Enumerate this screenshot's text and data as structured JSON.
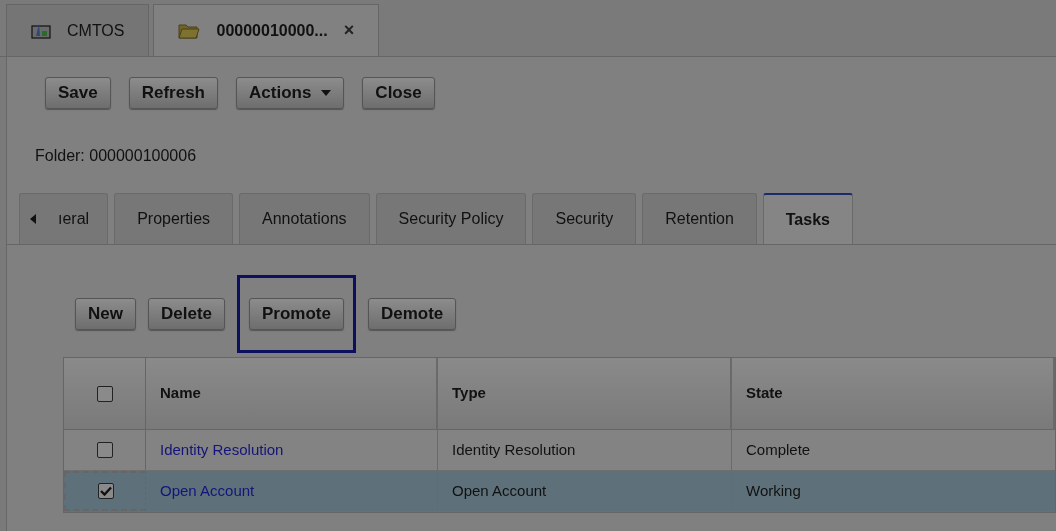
{
  "main_tabs": [
    {
      "label": "CMTOS",
      "kind": "app",
      "selected": false
    },
    {
      "label": "00000010000...",
      "kind": "folder",
      "selected": true,
      "close": "×"
    }
  ],
  "toolbar": [
    {
      "label": "Save",
      "dropdown": false
    },
    {
      "label": "Refresh",
      "dropdown": false
    },
    {
      "label": "Actions",
      "dropdown": true
    },
    {
      "label": "Close",
      "dropdown": false
    }
  ],
  "folder_label": "Folder: 000000100006",
  "detail_tabs": [
    {
      "label": "ıeral",
      "selected": false
    },
    {
      "label": "Properties",
      "selected": false
    },
    {
      "label": "Annotations",
      "selected": false
    },
    {
      "label": "Security Policy",
      "selected": false
    },
    {
      "label": "Security",
      "selected": false
    },
    {
      "label": "Retention",
      "selected": false
    },
    {
      "label": "Tasks",
      "selected": true
    }
  ],
  "task_buttons": [
    {
      "label": "New",
      "highlighted": false
    },
    {
      "label": "Delete",
      "highlighted": false
    },
    {
      "label": "Promote",
      "highlighted": true
    },
    {
      "label": "Demote",
      "highlighted": false
    }
  ],
  "table": {
    "header_checked": false,
    "columns": [
      "Name",
      "Type",
      "State"
    ],
    "rows": [
      {
        "checked": false,
        "selected": false,
        "name": "Identity Resolution",
        "type": "Identity Resolution",
        "state": "Complete"
      },
      {
        "checked": true,
        "selected": true,
        "name": "Open Account",
        "type": "Open Account",
        "state": "Working"
      }
    ]
  }
}
